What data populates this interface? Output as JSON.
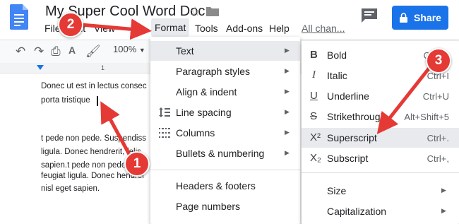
{
  "header": {
    "title": "My Super Cool Word Doc",
    "star_icon": "star-outline-icon",
    "folder_icon": "folder-icon",
    "share_label": "Share",
    "share_color": "#1a73e8"
  },
  "menubar": {
    "items": [
      "File",
      "Edit",
      "View",
      "Format",
      "Tools",
      "Add-ons",
      "Help"
    ],
    "all_changes": "All chan..."
  },
  "toolbar": {
    "zoom": "100%"
  },
  "ruler": {
    "mark": "1"
  },
  "document": {
    "lines": [
      "Donec ut est in lectus consec",
      "porta tristique",
      "t pede non pede. Suspendiss",
      "ligula. Donec hendrerit, felis",
      "sapien.t pede non pede. Susp",
      "feugiat ligula. Donec hendrer",
      "nisl eget sapien."
    ]
  },
  "format_menu": {
    "items": [
      {
        "label": "Text",
        "icon": "",
        "has_submenu": true
      },
      {
        "label": "Paragraph styles",
        "icon": "",
        "has_submenu": true
      },
      {
        "label": "Align & indent",
        "icon": "",
        "has_submenu": true
      },
      {
        "label": "Line spacing",
        "icon": "line-spacing-icon",
        "has_submenu": true
      },
      {
        "label": "Columns",
        "icon": "columns-icon",
        "has_submenu": true
      },
      {
        "label": "Bullets & numbering",
        "icon": "",
        "has_submenu": true
      },
      {
        "label": "Headers & footers",
        "icon": "",
        "has_submenu": false
      },
      {
        "label": "Page numbers",
        "icon": "",
        "has_submenu": false
      }
    ]
  },
  "text_submenu": {
    "items": [
      {
        "label": "Bold",
        "shortcut": "Ctrl+B",
        "icon": "B"
      },
      {
        "label": "Italic",
        "shortcut": "Ctrl+I",
        "icon": "I"
      },
      {
        "label": "Underline",
        "shortcut": "Ctrl+U",
        "icon": "U"
      },
      {
        "label": "Strikethrough",
        "shortcut": "Alt+Shift+5",
        "icon": "S"
      },
      {
        "label": "Superscript",
        "shortcut": "Ctrl+.",
        "icon": "X²"
      },
      {
        "label": "Subscript",
        "shortcut": "Ctrl+,",
        "icon": "X₂"
      },
      {
        "label": "Size",
        "shortcut": "",
        "icon": ""
      },
      {
        "label": "Capitalization",
        "shortcut": "",
        "icon": ""
      }
    ]
  },
  "annotations": {
    "badge1": "1",
    "badge2": "2",
    "badge3": "3",
    "color": "#e53935"
  }
}
